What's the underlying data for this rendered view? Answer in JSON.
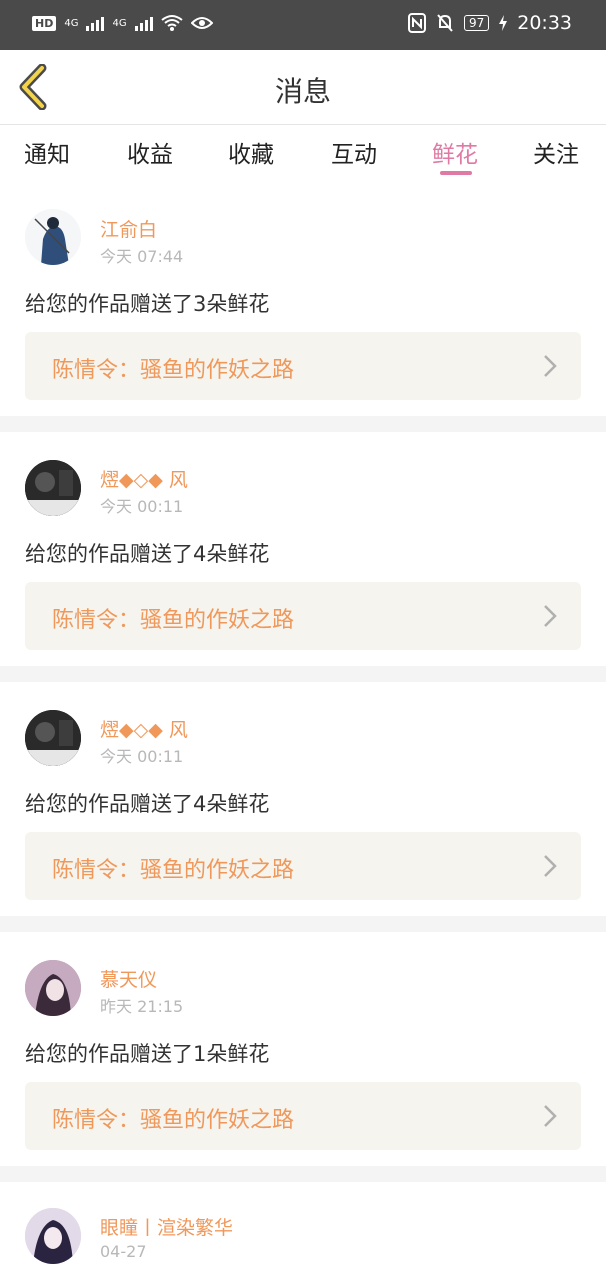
{
  "status_bar": {
    "hd": "HD",
    "net1": "4G",
    "net2": "4G",
    "battery": "97",
    "time": "20:33"
  },
  "header": {
    "title": "消息"
  },
  "tabs": [
    {
      "label": "通知"
    },
    {
      "label": "收益"
    },
    {
      "label": "收藏"
    },
    {
      "label": "互动"
    },
    {
      "label": "鲜花",
      "active": true
    },
    {
      "label": "关注"
    }
  ],
  "messages": [
    {
      "name": "江俞白",
      "time": "今天 07:44",
      "text": "给您的作品赠送了3朵鲜花",
      "work": "陈情令：骚鱼的作妖之路"
    },
    {
      "name": "熤◆◇◆ 风",
      "time": "今天 00:11",
      "text": "给您的作品赠送了4朵鲜花",
      "work": "陈情令：骚鱼的作妖之路"
    },
    {
      "name": "熤◆◇◆ 风",
      "time": "今天 00:11",
      "text": "给您的作品赠送了4朵鲜花",
      "work": "陈情令：骚鱼的作妖之路"
    },
    {
      "name": "慕天仪",
      "time": "昨天 21:15",
      "text": "给您的作品赠送了1朵鲜花",
      "work": "陈情令：骚鱼的作妖之路"
    },
    {
      "name": "眼瞳丨渲染繁华",
      "time": "04-27"
    }
  ],
  "colors": {
    "accent": "#e07aa5",
    "name": "#f0985a",
    "status_bar": "#4a4a4a",
    "work_bg": "#f5f4ee"
  }
}
